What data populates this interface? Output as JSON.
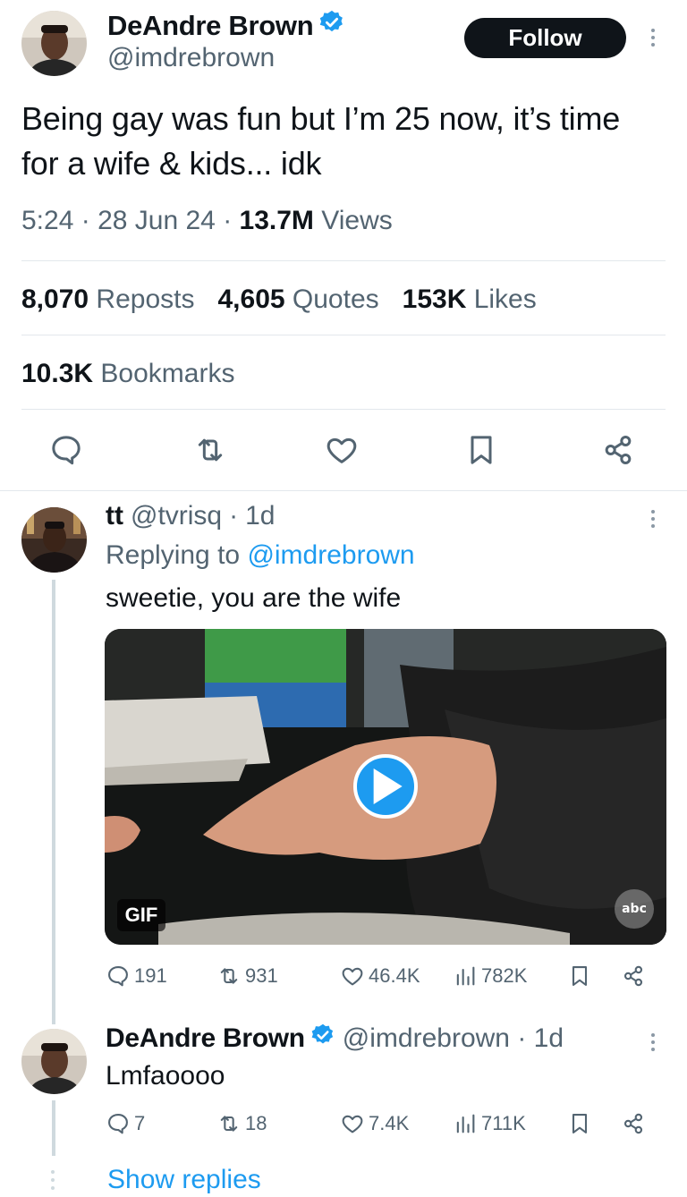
{
  "main_tweet": {
    "author_name": "DeAndre Brown",
    "author_handle": "@imdrebrown",
    "follow_label": "Follow",
    "text": "Being gay was fun but I’m 25 now, it’s time for a wife & kids... idk",
    "time": "5:24",
    "date": "28 Jun 24",
    "views_count": "13.7M",
    "views_label": "Views",
    "reposts_count": "8,070",
    "reposts_label": "Reposts",
    "quotes_count": "4,605",
    "quotes_label": "Quotes",
    "likes_count": "153K",
    "likes_label": "Likes",
    "bookmarks_count": "10.3K",
    "bookmarks_label": "Bookmarks"
  },
  "reply": {
    "author_name": "tt",
    "author_handle": "@tvrisq",
    "age": "1d",
    "replying_prefix": "Replying to",
    "replying_handle": "@imdrebrown",
    "text": "sweetie, you are the wife",
    "gif_badge": "GIF",
    "watermark": "abc",
    "replies": "191",
    "reposts": "931",
    "likes": "46.4K",
    "views": "782K"
  },
  "author_reply": {
    "author_name": "DeAndre Brown",
    "author_handle": "@imdrebrown",
    "age": "1d",
    "text": "Lmfaoooo",
    "replies": "7",
    "reposts": "18",
    "likes": "7.4K",
    "views": "711K"
  },
  "show_replies_label": "Show replies",
  "colors": {
    "accent": "#1d9bf0",
    "text": "#0f1419",
    "secondary": "#536471",
    "divider": "#e3e8ec"
  }
}
